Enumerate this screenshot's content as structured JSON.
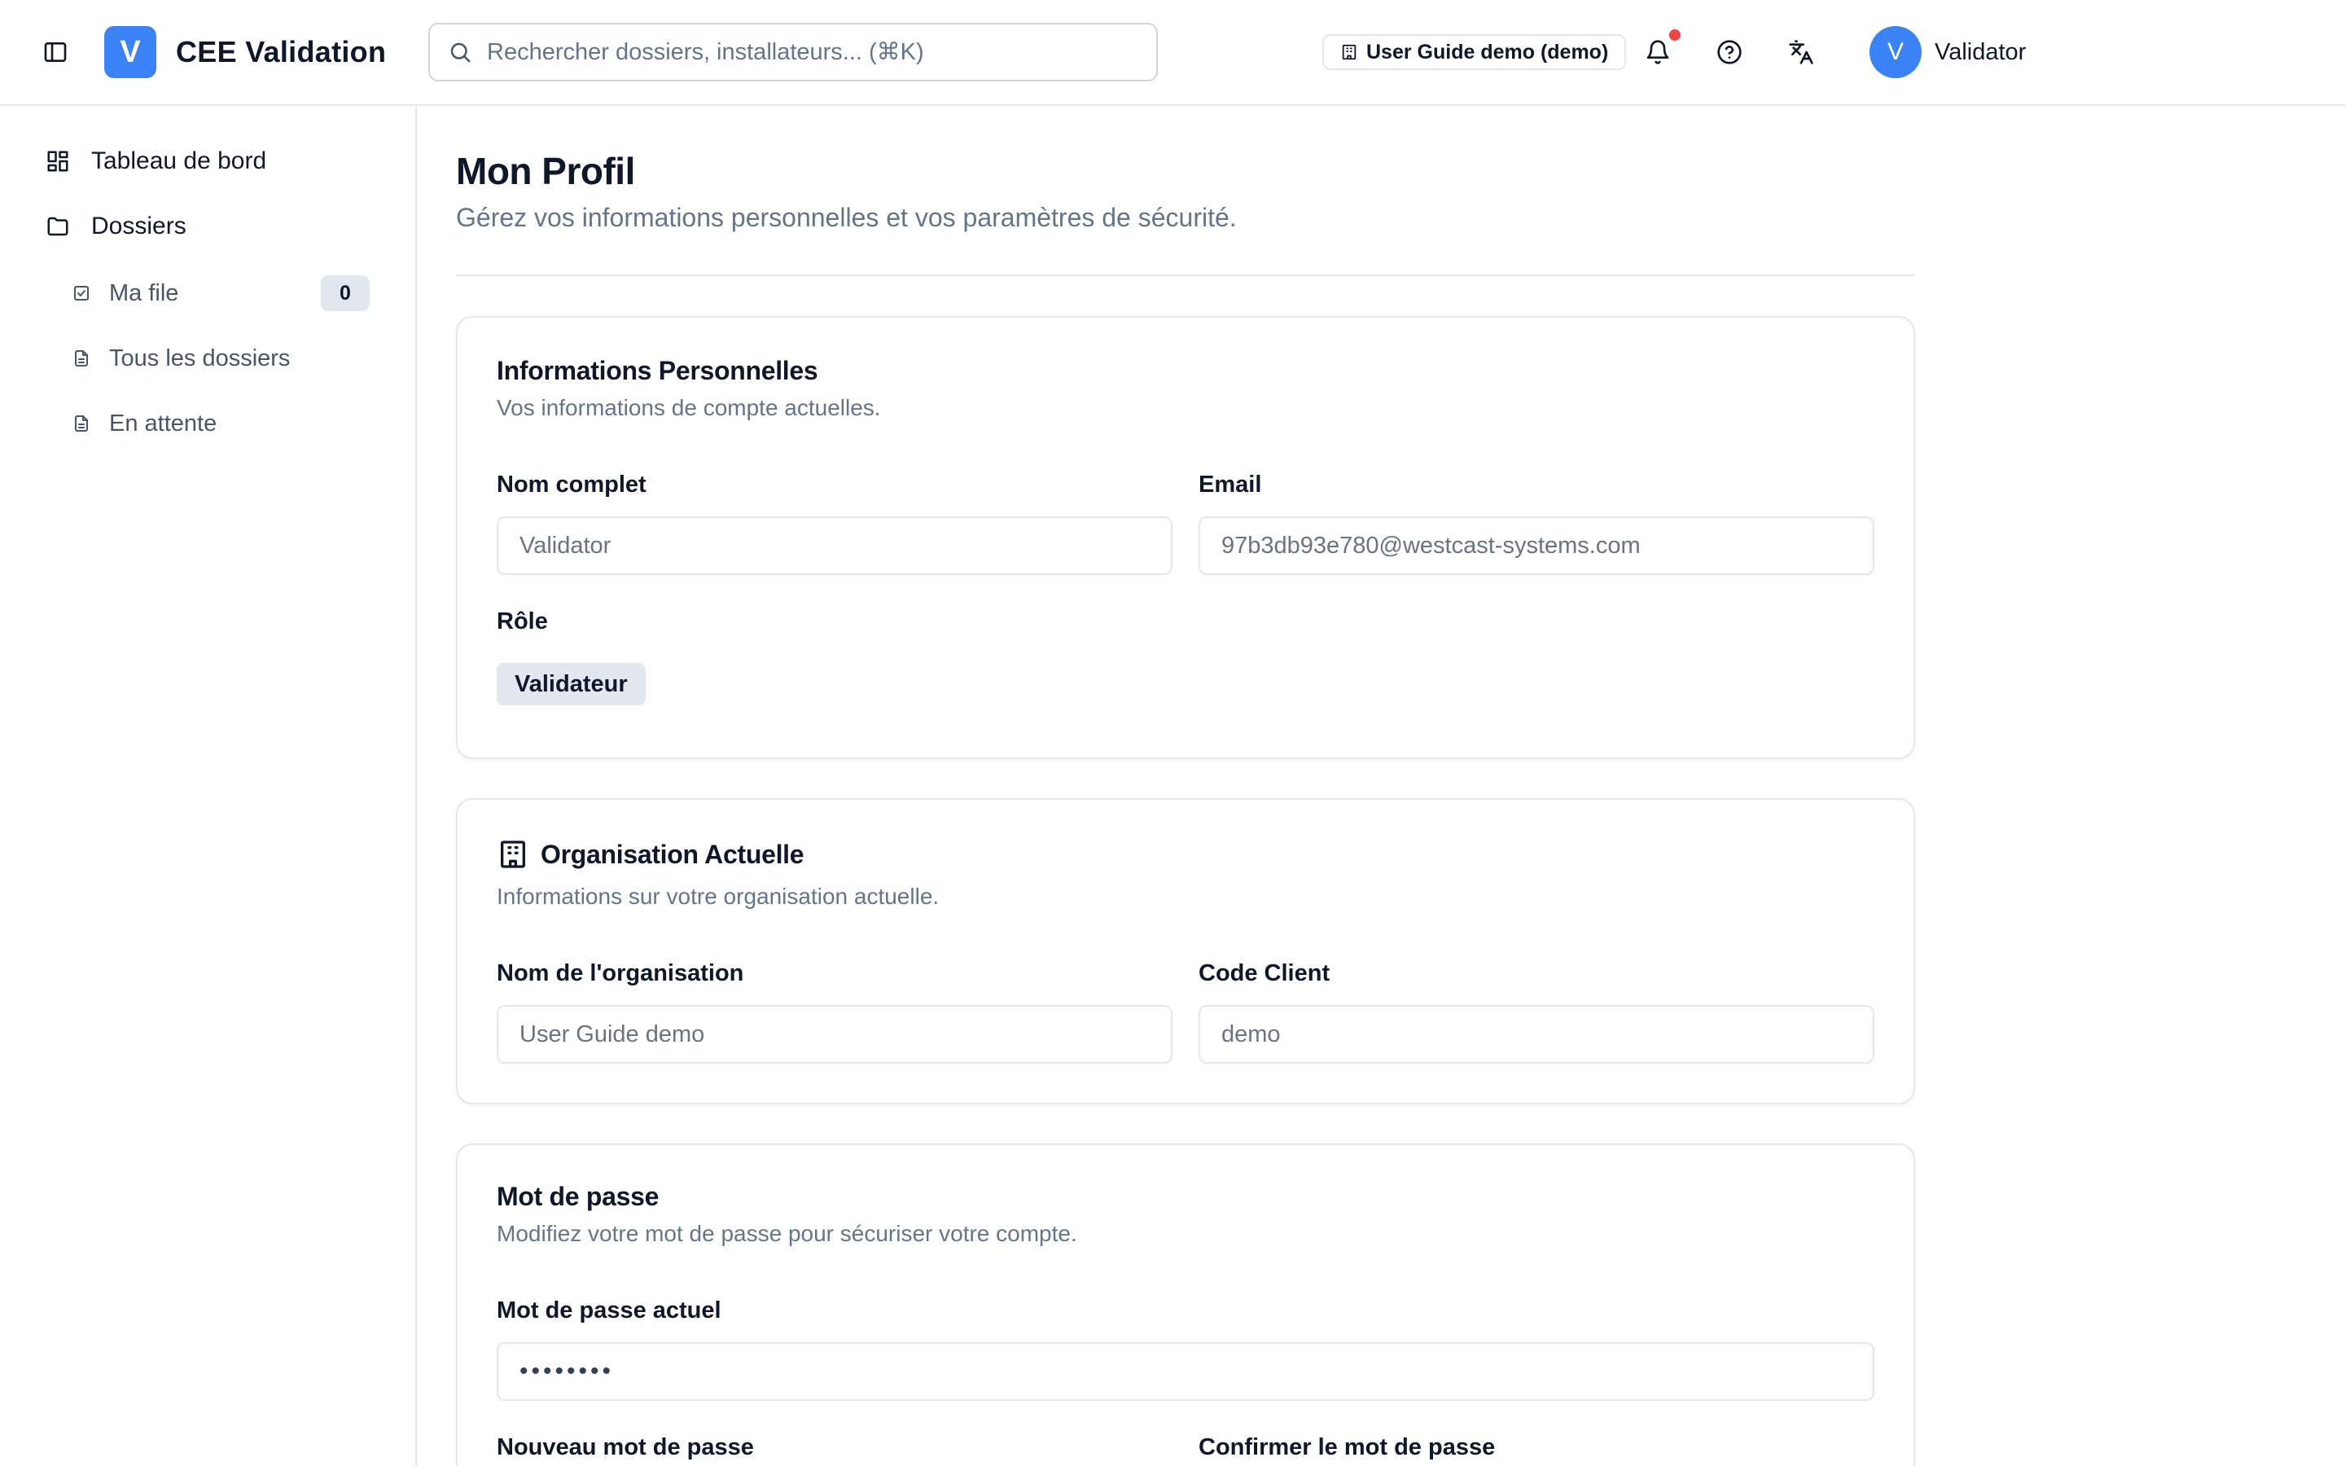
{
  "header": {
    "logo_letter": "V",
    "app_title": "CEE Validation",
    "search_placeholder": "Rechercher dossiers, installateurs... (⌘K)",
    "org_badge": "User Guide demo (demo)",
    "user_initial": "V",
    "user_name": "Validator",
    "notification_dot_color": "#ef4444",
    "icons": [
      "sidebar-toggle-icon",
      "search-icon",
      "building-icon",
      "bell-icon",
      "help-circle-icon",
      "translate-icon"
    ]
  },
  "sidebar": {
    "items": [
      {
        "label": "Tableau de bord",
        "icon": "dashboard-icon"
      },
      {
        "label": "Dossiers",
        "icon": "folder-icon"
      }
    ],
    "sub_items": [
      {
        "label": "Ma file",
        "icon": "checkbox-icon",
        "count": "0"
      },
      {
        "label": "Tous les dossiers",
        "icon": "document-icon"
      },
      {
        "label": "En attente",
        "icon": "document-icon"
      }
    ]
  },
  "main": {
    "title": "Mon Profil",
    "subtitle": "Gérez vos informations personnelles et vos paramètres de sécurité.",
    "personal": {
      "title": "Informations Personnelles",
      "description": "Vos informations de compte actuelles.",
      "name_label": "Nom complet",
      "name_value": "Validator",
      "email_label": "Email",
      "email_value": "97b3db93e780@westcast-systems.com",
      "role_label": "Rôle",
      "role_value": "Validateur"
    },
    "organization": {
      "title": "Organisation Actuelle",
      "description": "Informations sur votre organisation actuelle.",
      "org_name_label": "Nom de l'organisation",
      "org_name_value": "User Guide demo",
      "client_code_label": "Code Client",
      "client_code_value": "demo"
    },
    "password": {
      "title": "Mot de passe",
      "description": "Modifiez votre mot de passe pour sécuriser votre compte.",
      "current_label": "Mot de passe actuel",
      "current_value": "••••••••",
      "new_label": "Nouveau mot de passe",
      "confirm_label": "Confirmer le mot de passe"
    }
  },
  "colors": {
    "accent": "#3b82f6",
    "text_primary": "#0f172a",
    "text_muted": "#64748b",
    "badge_bg": "#e2e8f0"
  }
}
